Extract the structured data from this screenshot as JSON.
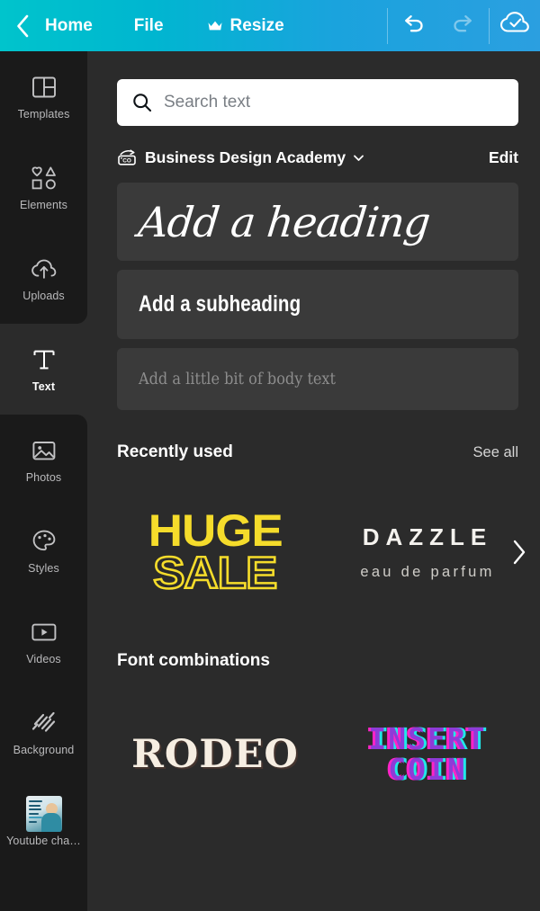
{
  "topbar": {
    "back_icon": "chevron-left-icon",
    "home_label": "Home",
    "file_label": "File",
    "resize_label": "Resize",
    "resize_crown_icon": "crown-icon",
    "undo_icon": "undo-icon",
    "redo_icon": "redo-icon",
    "save_icon": "cloud-check-icon",
    "gradient_start": "#00c4cc",
    "gradient_end": "#2b9fe0"
  },
  "sidebar": {
    "items": [
      {
        "label": "Templates",
        "icon": "templates-icon",
        "active": false
      },
      {
        "label": "Elements",
        "icon": "elements-icon",
        "active": false
      },
      {
        "label": "Uploads",
        "icon": "uploads-icon",
        "active": false
      },
      {
        "label": "Text",
        "icon": "text-icon",
        "active": true
      },
      {
        "label": "Photos",
        "icon": "photos-icon",
        "active": false
      },
      {
        "label": "Styles",
        "icon": "styles-icon",
        "active": false
      },
      {
        "label": "Videos",
        "icon": "videos-icon",
        "active": false
      },
      {
        "label": "Background",
        "icon": "background-icon",
        "active": false
      },
      {
        "label": "Youtube cha…",
        "icon": "youtube-channel-thumbnail",
        "active": false
      }
    ]
  },
  "panel": {
    "search": {
      "icon": "search-icon",
      "placeholder": "Search text",
      "value": ""
    },
    "brandkit": {
      "icon": "brand-kit-icon",
      "name": "Business Design Academy",
      "caret_icon": "chevron-down-icon",
      "edit_label": "Edit"
    },
    "text_styles": [
      {
        "id": "heading",
        "label": "Add a heading"
      },
      {
        "id": "subheading",
        "label": "Add a subheading"
      },
      {
        "id": "body",
        "label": "Add a little bit of body text"
      }
    ],
    "recently_used": {
      "title": "Recently used",
      "see_all_label": "See all",
      "next_icon": "chevron-right-icon",
      "items": [
        {
          "id": "huge-sale",
          "line1": "HUGE",
          "line2": "SALE",
          "color": "#f5dc2b"
        },
        {
          "id": "dazzle",
          "line1": "DAZZLE",
          "line2": "eau de parfum",
          "color": "#f4f2ee"
        }
      ]
    },
    "font_combinations": {
      "title": "Font combinations",
      "items": [
        {
          "id": "rodeo",
          "line1": "RODEO",
          "color": "#f6eee2"
        },
        {
          "id": "insert-coin",
          "line1": "INSERT",
          "line2": "COIN",
          "color": "#8e3bd8"
        }
      ]
    }
  }
}
